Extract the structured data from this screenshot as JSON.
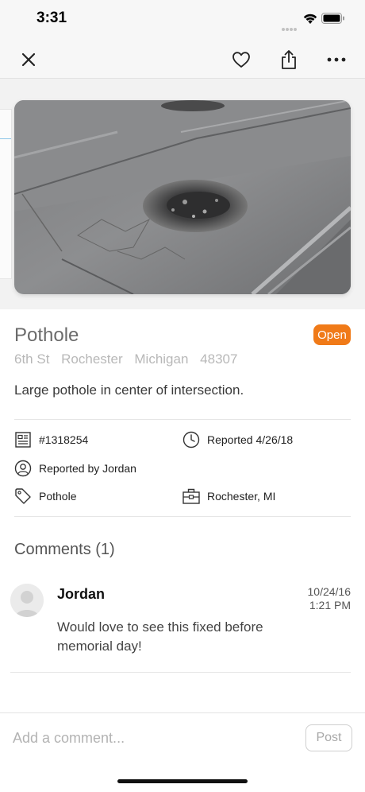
{
  "status_bar": {
    "time": "3:31"
  },
  "nav": {
    "close_icon": "close-icon",
    "favorite_icon": "heart-icon",
    "share_icon": "share-icon",
    "more_icon": "more-icon"
  },
  "issue": {
    "title": "Pothole",
    "status": "Open",
    "status_color": "#f07a18",
    "address": [
      "6th St",
      "Rochester",
      "Michigan",
      "48307"
    ],
    "description": "Large pothole in center of intersection."
  },
  "details": {
    "id": "#1318254",
    "reported_date": "Reported 4/26/18",
    "reported_by": "Reported by Jordan",
    "category": "Pothole",
    "location": "Rochester, MI"
  },
  "comments": {
    "heading": "Comments (1)",
    "items": [
      {
        "author": "Jordan",
        "date": "10/24/16",
        "time": "1:21 PM",
        "text": "Would love to see this fixed before memorial day!"
      }
    ]
  },
  "compose": {
    "placeholder": "Add a comment...",
    "post_label": "Post"
  }
}
